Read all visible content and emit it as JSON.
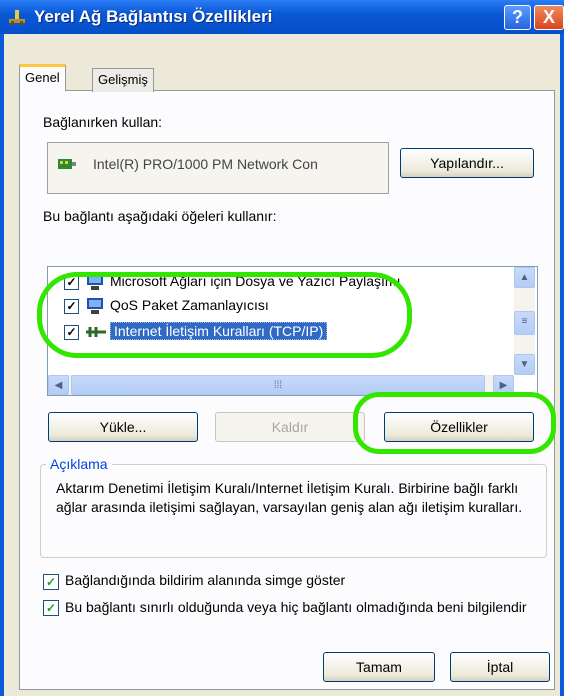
{
  "window": {
    "title": "Yerel Ağ Bağlantısı Özellikleri",
    "help_label": "?",
    "close_label": "X"
  },
  "tabs": [
    {
      "label": "Genel",
      "active": true
    },
    {
      "label": "Gelişmiş",
      "active": false
    }
  ],
  "connect_using": {
    "label": "Bağlanırken kullan:",
    "adapter_name": "Intel(R) PRO/1000 PM Network Con",
    "configure_label": "Yapılandır..."
  },
  "components": {
    "label": "Bu bağlantı aşağıdaki öğeleri kullanır:",
    "items": [
      {
        "label": "Microsoft Ağları için Dosya ve Yazıcı Paylaşımı",
        "checked": true,
        "selected": false
      },
      {
        "label": "QoS Paket Zamanlayıcısı",
        "checked": true,
        "selected": false
      },
      {
        "label": "Internet İletişim Kuralları (TCP/IP)",
        "checked": true,
        "selected": true
      }
    ]
  },
  "buttons": {
    "install": "Yükle...",
    "uninstall": "Kaldır",
    "properties": "Özellikler"
  },
  "description": {
    "title": "Açıklama",
    "text": "Aktarım Denetimi İletişim Kuralı/Internet İletişim Kuralı. Birbirine bağlı farklı ağlar arasında iletişimi sağlayan, varsayılan geniş alan ağı iletişim kuralları."
  },
  "options": [
    {
      "label": "Bağlandığında bildirim alanında simge göster",
      "checked": true
    },
    {
      "label": "Bu bağlantı sınırlı olduğunda veya hiç bağlantı olmadığında beni bilgilendir",
      "checked": true
    }
  ],
  "footer": {
    "ok": "Tamam",
    "cancel": "İptal"
  },
  "colors": {
    "titlebar": "#0a5bd8",
    "selection": "#316ac5",
    "highlight": "#33e600"
  }
}
